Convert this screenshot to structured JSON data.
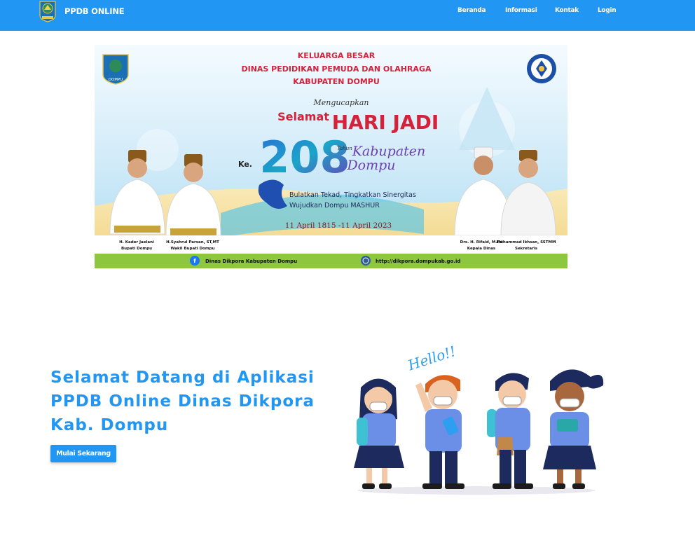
{
  "navbar": {
    "brand": "PPDB ONLINE",
    "logo_icon": "dompu-regency-logo-icon",
    "color": "#2196f3",
    "links": [
      "Beranda",
      "Informasi",
      "Kontak",
      "Login"
    ]
  },
  "banner": {
    "header_lines": [
      "KELUARGA BESAR",
      "DINAS PEDIDIKAN PEMUDA DAN OLAHRAGA",
      "KABUPATEN DOMPU"
    ],
    "logo_left_text": "DOMPU",
    "mengucapkan": "Mengucapkan",
    "selamat": "Selamat",
    "hari_jadi": "HARI JADI",
    "ke": "Ke.",
    "number": "208",
    "tahun": "Tahun",
    "kabupaten": "Kabupaten",
    "dompu": "Dompu",
    "slogan_1": "Bulatkan Tekad, Tingkatkan Sinergitas",
    "slogan_2": "Wujudkan Dompu MASHUR",
    "date": "11 April 1815 -11 April 2023",
    "officials": [
      {
        "name": "H. Kader Jaelani",
        "role": "Bupati Dompu"
      },
      {
        "name": "H.Syahrul Parsan, ST,MT",
        "role": "Wakil Bupati Dompu"
      },
      {
        "name": "Drs. H. Rifaid, M.Pd",
        "role": "Kepala Dinas"
      },
      {
        "name": "Muhammad Ikhsan, SSTMM",
        "role": "Sekretaris"
      }
    ],
    "facebook": "Dinas Dikpora Kabupaten Dompu",
    "website": "http://dikpora.dompukab.go.id"
  },
  "hero": {
    "title": "Selamat Datang di Aplikasi PPDB Online Dinas Dikpora Kab. Dompu",
    "button": "Mulai Sekarang",
    "illustration_text": "Hello!!",
    "illustration_icon": "students-with-masks-illustration"
  }
}
